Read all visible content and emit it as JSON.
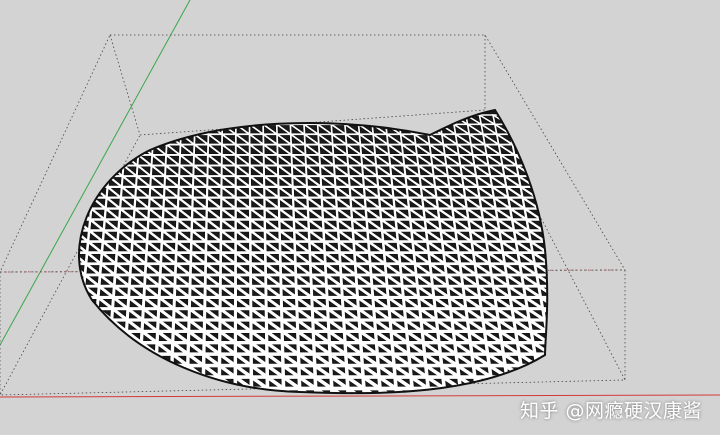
{
  "viewport": {
    "background": "#d3d3d3",
    "axes": {
      "red": "#d23a3a",
      "green": "#3aa64a",
      "blue": "#3a5ad2"
    },
    "bounding_box_style": "dotted"
  },
  "model": {
    "type": "triangulated-lattice-surface",
    "strut_color": "#ffffff",
    "edge_color": "#111111",
    "selected": true
  },
  "watermark": {
    "text": "知乎 @网瘾硬汉康酱"
  }
}
